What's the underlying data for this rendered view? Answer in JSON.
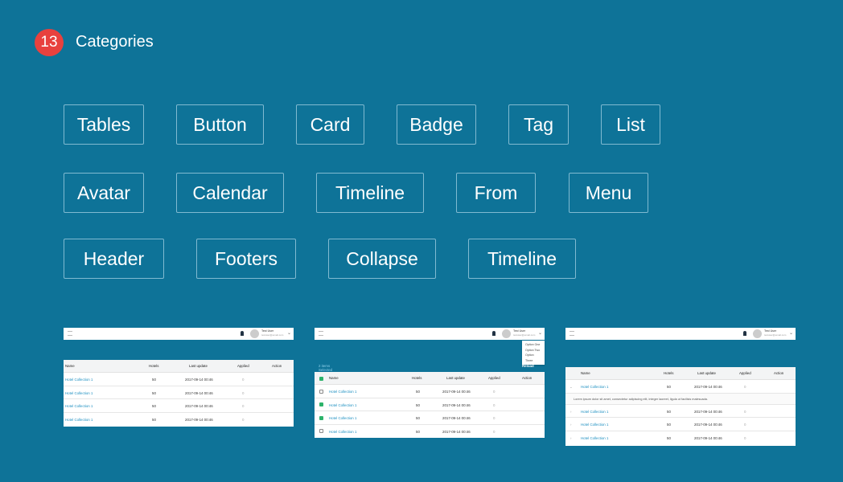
{
  "header": {
    "number": "13",
    "title": "Categories"
  },
  "categories": [
    "Tables",
    "Button",
    "Card",
    "Badge",
    "Tag",
    "List",
    "Avatar",
    "Calendar",
    "Timeline",
    "From",
    "Menu",
    "Header",
    "Footers",
    "Collapse",
    "Timeline"
  ],
  "previews": {
    "user_name": "Test User",
    "user_email": "testuser@email.com",
    "columns": [
      "Name",
      "Hotels",
      "Last update",
      "Applied",
      "Action"
    ],
    "rows": [
      {
        "name": "Hotel Collection 1",
        "hotels": "50",
        "updated": "2017-09-14 00:46",
        "applied": "0"
      },
      {
        "name": "Hotel Collection 1",
        "hotels": "50",
        "updated": "2017-09-14 00:46",
        "applied": "0"
      },
      {
        "name": "Hotel Collection 1",
        "hotels": "50",
        "updated": "2017-09-14 00:46",
        "applied": "0"
      },
      {
        "name": "Hotel Collection 1",
        "hotels": "50",
        "updated": "2017-09-14 00:46",
        "applied": "0"
      }
    ],
    "selected_text": "2 items Selected",
    "reload_label": "Reload",
    "dropdown_options": [
      "Option One",
      "Option Two",
      "Option Three"
    ],
    "checked": [
      false,
      true,
      true,
      false
    ],
    "expanded_text": "Lorem ipsum dolor sit amet, consectetur adipiscing elit, integer laoreet, ligula ut facilisis malesuada."
  },
  "colors": {
    "background": "#0e7398",
    "badge": "#e8413e",
    "link": "#1a8ec0",
    "checkbox": "#2db36b"
  }
}
